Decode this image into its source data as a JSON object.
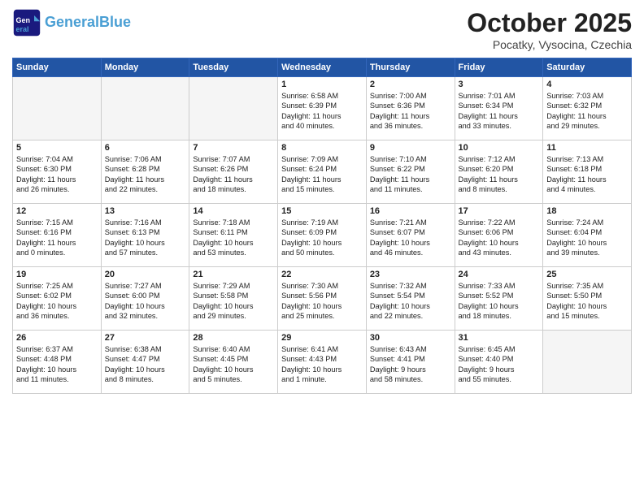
{
  "header": {
    "logo_line1": "General",
    "logo_line2": "Blue",
    "month": "October 2025",
    "location": "Pocatky, Vysocina, Czechia"
  },
  "days_of_week": [
    "Sunday",
    "Monday",
    "Tuesday",
    "Wednesday",
    "Thursday",
    "Friday",
    "Saturday"
  ],
  "weeks": [
    [
      {
        "day": "",
        "content": "",
        "empty": true
      },
      {
        "day": "",
        "content": "",
        "empty": true
      },
      {
        "day": "",
        "content": "",
        "empty": true
      },
      {
        "day": "1",
        "content": "Sunrise: 6:58 AM\nSunset: 6:39 PM\nDaylight: 11 hours\nand 40 minutes.",
        "empty": false
      },
      {
        "day": "2",
        "content": "Sunrise: 7:00 AM\nSunset: 6:36 PM\nDaylight: 11 hours\nand 36 minutes.",
        "empty": false
      },
      {
        "day": "3",
        "content": "Sunrise: 7:01 AM\nSunset: 6:34 PM\nDaylight: 11 hours\nand 33 minutes.",
        "empty": false
      },
      {
        "day": "4",
        "content": "Sunrise: 7:03 AM\nSunset: 6:32 PM\nDaylight: 11 hours\nand 29 minutes.",
        "empty": false
      }
    ],
    [
      {
        "day": "5",
        "content": "Sunrise: 7:04 AM\nSunset: 6:30 PM\nDaylight: 11 hours\nand 26 minutes.",
        "empty": false
      },
      {
        "day": "6",
        "content": "Sunrise: 7:06 AM\nSunset: 6:28 PM\nDaylight: 11 hours\nand 22 minutes.",
        "empty": false
      },
      {
        "day": "7",
        "content": "Sunrise: 7:07 AM\nSunset: 6:26 PM\nDaylight: 11 hours\nand 18 minutes.",
        "empty": false
      },
      {
        "day": "8",
        "content": "Sunrise: 7:09 AM\nSunset: 6:24 PM\nDaylight: 11 hours\nand 15 minutes.",
        "empty": false
      },
      {
        "day": "9",
        "content": "Sunrise: 7:10 AM\nSunset: 6:22 PM\nDaylight: 11 hours\nand 11 minutes.",
        "empty": false
      },
      {
        "day": "10",
        "content": "Sunrise: 7:12 AM\nSunset: 6:20 PM\nDaylight: 11 hours\nand 8 minutes.",
        "empty": false
      },
      {
        "day": "11",
        "content": "Sunrise: 7:13 AM\nSunset: 6:18 PM\nDaylight: 11 hours\nand 4 minutes.",
        "empty": false
      }
    ],
    [
      {
        "day": "12",
        "content": "Sunrise: 7:15 AM\nSunset: 6:16 PM\nDaylight: 11 hours\nand 0 minutes.",
        "empty": false
      },
      {
        "day": "13",
        "content": "Sunrise: 7:16 AM\nSunset: 6:13 PM\nDaylight: 10 hours\nand 57 minutes.",
        "empty": false
      },
      {
        "day": "14",
        "content": "Sunrise: 7:18 AM\nSunset: 6:11 PM\nDaylight: 10 hours\nand 53 minutes.",
        "empty": false
      },
      {
        "day": "15",
        "content": "Sunrise: 7:19 AM\nSunset: 6:09 PM\nDaylight: 10 hours\nand 50 minutes.",
        "empty": false
      },
      {
        "day": "16",
        "content": "Sunrise: 7:21 AM\nSunset: 6:07 PM\nDaylight: 10 hours\nand 46 minutes.",
        "empty": false
      },
      {
        "day": "17",
        "content": "Sunrise: 7:22 AM\nSunset: 6:06 PM\nDaylight: 10 hours\nand 43 minutes.",
        "empty": false
      },
      {
        "day": "18",
        "content": "Sunrise: 7:24 AM\nSunset: 6:04 PM\nDaylight: 10 hours\nand 39 minutes.",
        "empty": false
      }
    ],
    [
      {
        "day": "19",
        "content": "Sunrise: 7:25 AM\nSunset: 6:02 PM\nDaylight: 10 hours\nand 36 minutes.",
        "empty": false
      },
      {
        "day": "20",
        "content": "Sunrise: 7:27 AM\nSunset: 6:00 PM\nDaylight: 10 hours\nand 32 minutes.",
        "empty": false
      },
      {
        "day": "21",
        "content": "Sunrise: 7:29 AM\nSunset: 5:58 PM\nDaylight: 10 hours\nand 29 minutes.",
        "empty": false
      },
      {
        "day": "22",
        "content": "Sunrise: 7:30 AM\nSunset: 5:56 PM\nDaylight: 10 hours\nand 25 minutes.",
        "empty": false
      },
      {
        "day": "23",
        "content": "Sunrise: 7:32 AM\nSunset: 5:54 PM\nDaylight: 10 hours\nand 22 minutes.",
        "empty": false
      },
      {
        "day": "24",
        "content": "Sunrise: 7:33 AM\nSunset: 5:52 PM\nDaylight: 10 hours\nand 18 minutes.",
        "empty": false
      },
      {
        "day": "25",
        "content": "Sunrise: 7:35 AM\nSunset: 5:50 PM\nDaylight: 10 hours\nand 15 minutes.",
        "empty": false
      }
    ],
    [
      {
        "day": "26",
        "content": "Sunrise: 6:37 AM\nSunset: 4:48 PM\nDaylight: 10 hours\nand 11 minutes.",
        "empty": false
      },
      {
        "day": "27",
        "content": "Sunrise: 6:38 AM\nSunset: 4:47 PM\nDaylight: 10 hours\nand 8 minutes.",
        "empty": false
      },
      {
        "day": "28",
        "content": "Sunrise: 6:40 AM\nSunset: 4:45 PM\nDaylight: 10 hours\nand 5 minutes.",
        "empty": false
      },
      {
        "day": "29",
        "content": "Sunrise: 6:41 AM\nSunset: 4:43 PM\nDaylight: 10 hours\nand 1 minute.",
        "empty": false
      },
      {
        "day": "30",
        "content": "Sunrise: 6:43 AM\nSunset: 4:41 PM\nDaylight: 9 hours\nand 58 minutes.",
        "empty": false
      },
      {
        "day": "31",
        "content": "Sunrise: 6:45 AM\nSunset: 4:40 PM\nDaylight: 9 hours\nand 55 minutes.",
        "empty": false
      },
      {
        "day": "",
        "content": "",
        "empty": true
      }
    ]
  ]
}
